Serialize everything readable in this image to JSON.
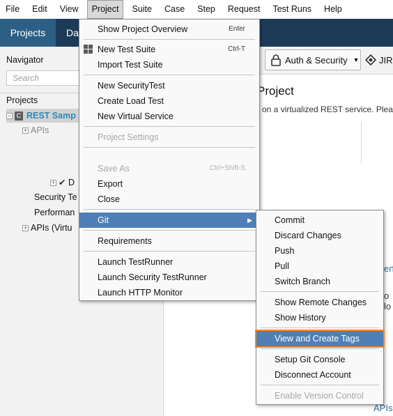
{
  "menubar": {
    "items": [
      "File",
      "Edit",
      "View",
      "Project",
      "Suite",
      "Case",
      "Step",
      "Request",
      "Test Runs",
      "Help"
    ],
    "active_index": 3
  },
  "tabbar": {
    "projects_label": "Projects",
    "dashboard_label": "Das"
  },
  "navigator": {
    "title": "Navigator",
    "search_placeholder": "Search",
    "projects_label": "Projects",
    "tree": {
      "rest_sample": "REST Samp",
      "apis": "APIs",
      "d_item": "D",
      "security": "Security Te",
      "performance": "Performan",
      "apis_virtual": "APIs (Virtu"
    }
  },
  "content": {
    "auth_label": "Auth & Security",
    "jira_label": "JIR",
    "heading": "Project",
    "description": "on a virtualized REST service. Plea",
    "frag_perf": "erf",
    "frag_lo": "o lo",
    "frag_apis": "APIs"
  },
  "project_menu": {
    "items": [
      {
        "label": "Show Project Overview",
        "shortcut": "Enter",
        "disabled": false
      },
      {
        "label": "New Test Suite",
        "shortcut": "Ctrl-T",
        "disabled": false,
        "icon": "test-suite-grid-icon"
      },
      {
        "label": "Import Test Suite",
        "shortcut": "",
        "disabled": false
      },
      {
        "label": "New SecurityTest",
        "shortcut": "",
        "disabled": false
      },
      {
        "label": "Create Load Test",
        "shortcut": "",
        "disabled": false
      },
      {
        "label": "New Virtual Service",
        "shortcut": "",
        "disabled": false
      },
      {
        "label": "Project Settings",
        "shortcut": "",
        "disabled": true
      },
      {
        "label": "Save As",
        "shortcut": "Ctrl+Shift-S",
        "disabled": true
      },
      {
        "label": "Export",
        "shortcut": "",
        "disabled": false
      },
      {
        "label": "Close",
        "shortcut": "",
        "disabled": false
      },
      {
        "label": "Git",
        "shortcut": "",
        "disabled": false,
        "highlighted": true
      },
      {
        "label": "Requirements",
        "shortcut": "",
        "disabled": false
      },
      {
        "label": "Launch TestRunner",
        "shortcut": "",
        "disabled": false
      },
      {
        "label": "Launch Security TestRunner",
        "shortcut": "",
        "disabled": false
      },
      {
        "label": "Launch HTTP Monitor",
        "shortcut": "",
        "disabled": false
      }
    ]
  },
  "git_menu": {
    "items": [
      {
        "label": "Commit",
        "disabled": false
      },
      {
        "label": "Discard Changes",
        "disabled": false
      },
      {
        "label": "Push",
        "disabled": false
      },
      {
        "label": "Pull",
        "disabled": false
      },
      {
        "label": "Switch Branch",
        "disabled": false
      },
      {
        "label": "Show Remote Changes",
        "disabled": false
      },
      {
        "label": "Show History",
        "disabled": false
      },
      {
        "label": "View and Create Tags",
        "disabled": false,
        "highlighted": true
      },
      {
        "label": "Setup Git Console",
        "disabled": false
      },
      {
        "label": "Disconnect Account",
        "disabled": false
      },
      {
        "label": "Enable Version Control",
        "disabled": true
      }
    ]
  },
  "colors": {
    "menu_highlight": "#4f7fb6",
    "tag_outline": "#ee8a23",
    "tab_bar": "#1d3b57",
    "active_tab": "#2d5f85",
    "project_name": "#2a8ab8"
  }
}
